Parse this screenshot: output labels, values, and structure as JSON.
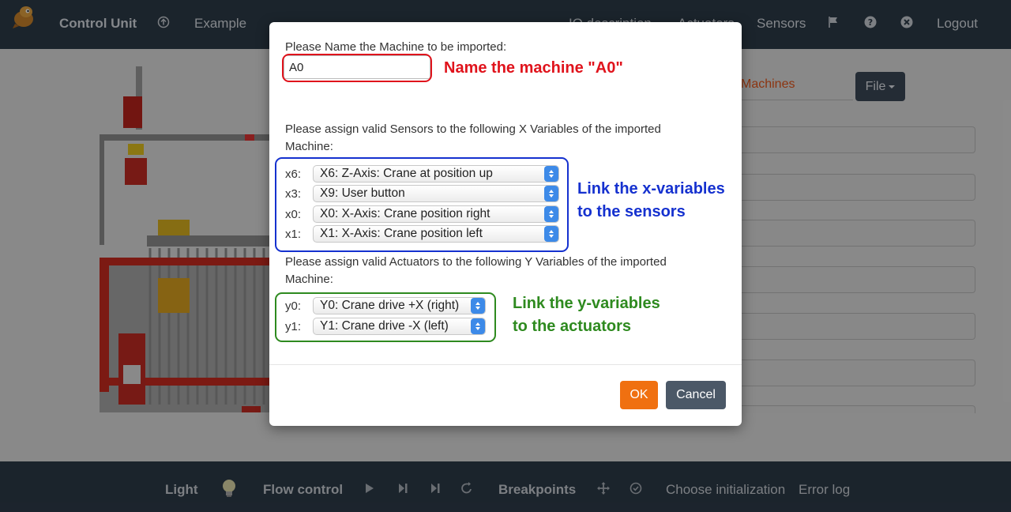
{
  "topnav": {
    "brand": "Control Unit",
    "example": "Example",
    "io_description": "IO description",
    "actuators": "Actuators",
    "sensors": "Sensors",
    "logout": "Logout"
  },
  "background": {
    "machines_tab": "Machines",
    "file_button": "File"
  },
  "bottombar": {
    "light": "Light",
    "flow_control": "Flow control",
    "breakpoints": "Breakpoints",
    "choose_init": "Choose initialization",
    "error_log": "Error log"
  },
  "modal": {
    "name_prompt": "Please Name the Machine to be imported:",
    "name_value": "A0",
    "x_prompt": "Please assign valid Sensors to the following X Variables of the imported Machine:",
    "x_vars": [
      {
        "label": "x6:",
        "value": "X6: Z-Axis: Crane at position up"
      },
      {
        "label": "x3:",
        "value": "X9: User button"
      },
      {
        "label": "x0:",
        "value": "X0: X-Axis: Crane position right"
      },
      {
        "label": "x1:",
        "value": "X1: X-Axis: Crane position left"
      }
    ],
    "y_prompt": "Please assign valid Actuators to the following Y Variables of the imported Machine:",
    "y_vars": [
      {
        "label": "y0:",
        "value": "Y0: Crane drive +X (right)"
      },
      {
        "label": "y1:",
        "value": "Y1: Crane drive -X (left)"
      }
    ],
    "ok": "OK",
    "cancel": "Cancel"
  },
  "annotations": {
    "name": "Name the machine \"A0\"",
    "x_line1": "Link the x-variables",
    "x_line2": "to the sensors",
    "y_line1": "Link the y-variables",
    "y_line2": "to the actuators"
  },
  "colors": {
    "annotation_red": "#e0131c",
    "annotation_blue": "#1531cf",
    "annotation_green": "#2e8a1f",
    "ok_orange": "#f07010",
    "nav_bg": "#2d3a48"
  }
}
